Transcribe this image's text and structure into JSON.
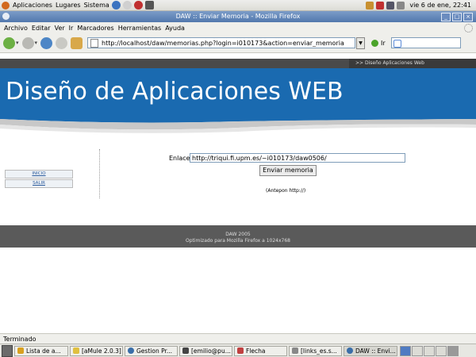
{
  "topbar": {
    "menus": [
      "Aplicaciones",
      "Lugares",
      "Sistema"
    ],
    "clock": "vie  6 de ene, 22:41"
  },
  "window": {
    "title": "DAW :: Enviar Memoria - Mozilla Firefox"
  },
  "menubar": [
    "Archivo",
    "Editar",
    "Ver",
    "Ir",
    "Marcadores",
    "Herramientas",
    "Ayuda"
  ],
  "navbar": {
    "url": "http://localhost/daw/memorias.php?login=i010173&action=enviar_memoria",
    "go_label": "Ir"
  },
  "page": {
    "top_tab": ">> Diseño Aplicaciones Web",
    "banner_title": "Diseño de Aplicaciones WEB",
    "sidebar": [
      "INICIO",
      "SALIR"
    ],
    "form": {
      "label": "Enlace",
      "value": "http://triqui.fi.upm.es/~i010173/daw0506/",
      "button": "Enviar memoria",
      "hint": "(Antepon http://)"
    },
    "footer": {
      "line1": "DAW 2005",
      "line2": "Optimizado para Mozilla Firefox a 1024x768"
    }
  },
  "statusbar": "Terminado",
  "taskbar": [
    {
      "label": "Lista de a...",
      "color": "#d8a020"
    },
    {
      "label": "[aMule 2.0.3]",
      "color": "#e0c040"
    },
    {
      "label": "Gestion Pr...",
      "color": "#3a6ea8"
    },
    {
      "label": "[emilio@pu...",
      "color": "#444444"
    },
    {
      "label": "Flecha",
      "color": "#c04040"
    },
    {
      "label": "[links_es.s...",
      "color": "#888888"
    },
    {
      "label": "DAW :: Envi...",
      "color": "#3a6ea8"
    }
  ]
}
